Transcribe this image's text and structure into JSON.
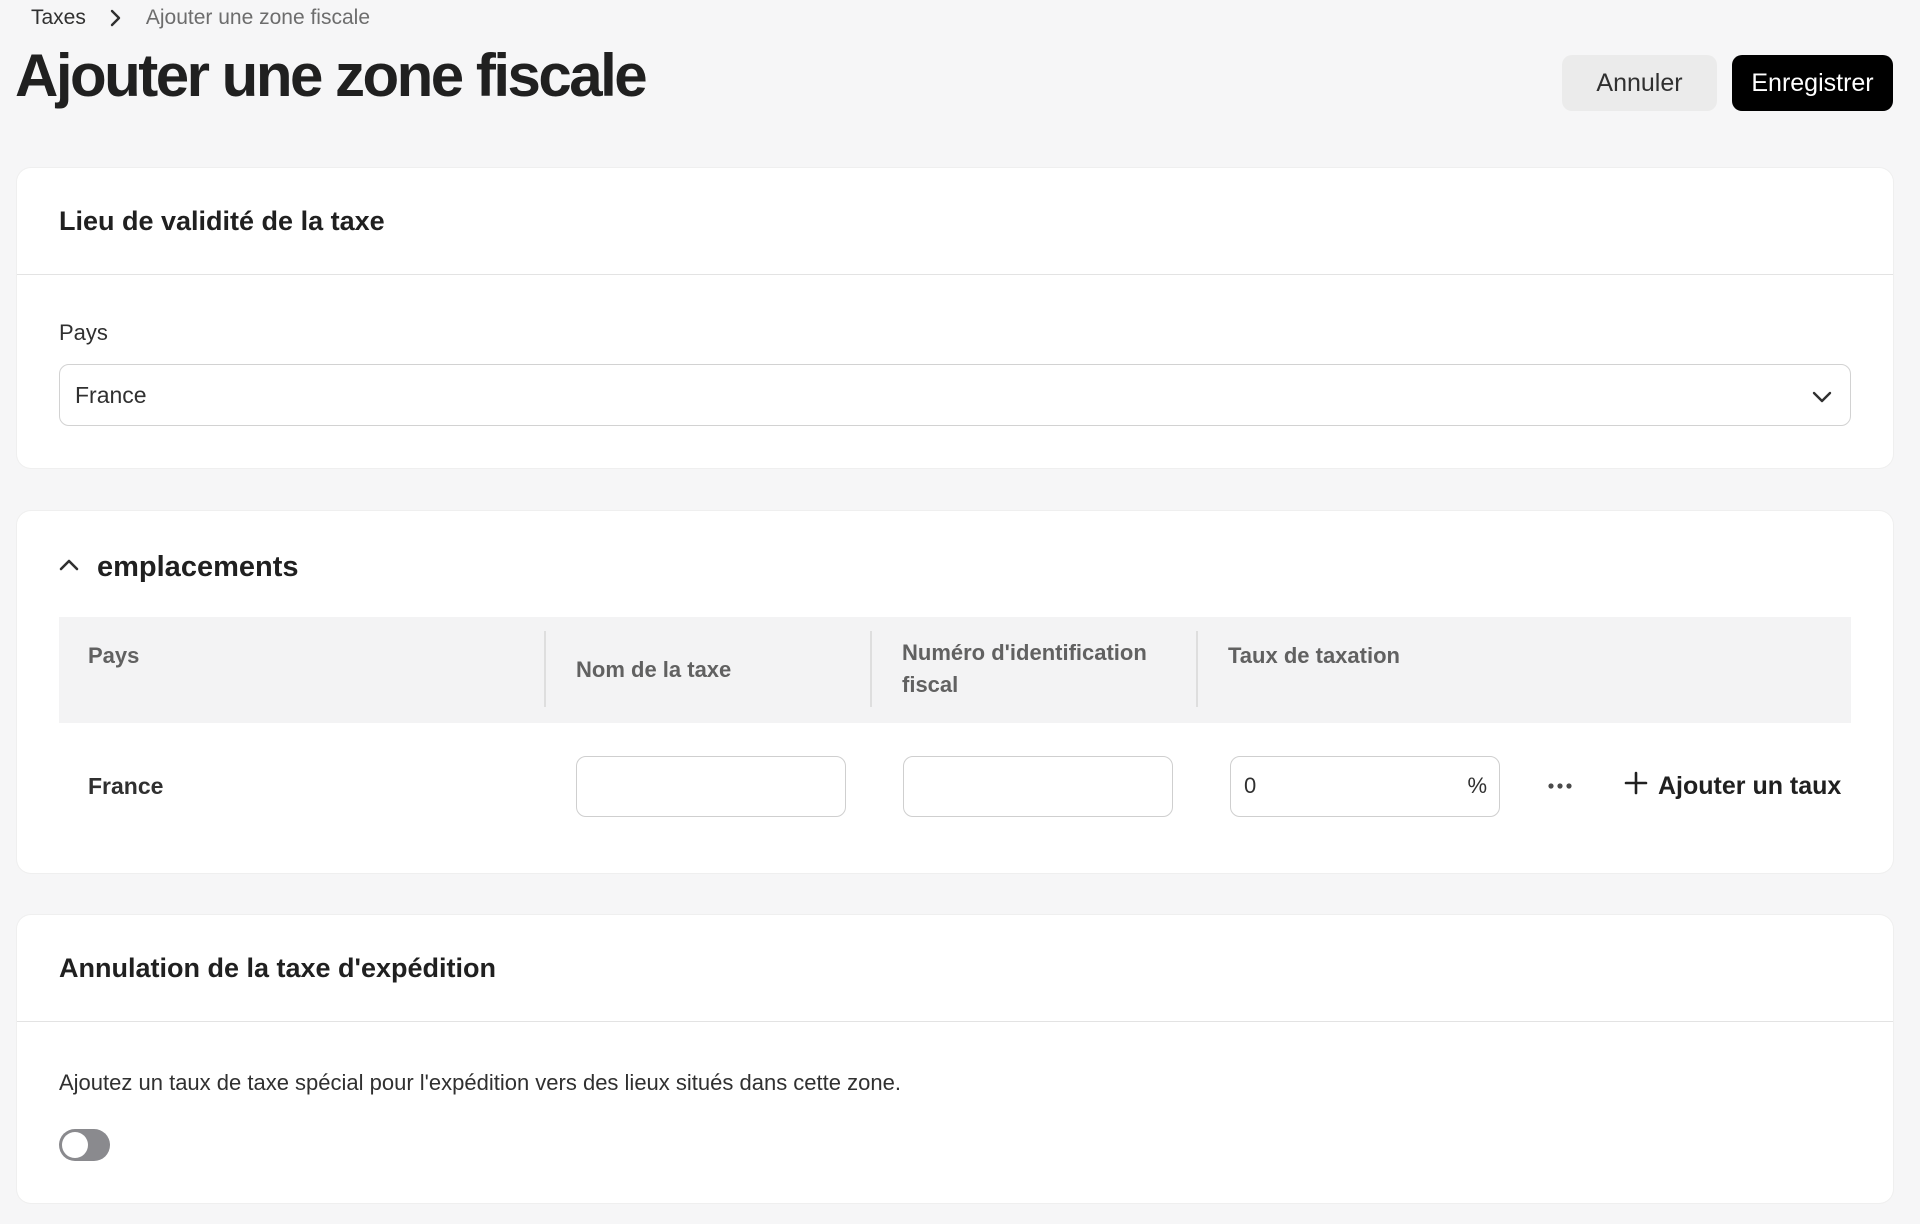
{
  "breadcrumb": {
    "parent": "Taxes",
    "current": "Ajouter une zone fiscale"
  },
  "page": {
    "title": "Ajouter une zone fiscale"
  },
  "actions": {
    "cancel_label": "Annuler",
    "save_label": "Enregistrer"
  },
  "validity": {
    "title": "Lieu de validité de la taxe",
    "country_label": "Pays",
    "country_value": "France"
  },
  "locations": {
    "title": "emplacements",
    "columns": [
      "Pays",
      "Nom de la taxe",
      "Numéro d'identification fiscal",
      "Taux de taxation"
    ],
    "rows": [
      {
        "country": "France",
        "tax_name": "",
        "tax_id": "",
        "rate": "0",
        "rate_unit": "%"
      }
    ],
    "add_rate_label": "Ajouter un taux"
  },
  "shipping_override": {
    "title": "Annulation de la taxe d'expédition",
    "description": "Ajoutez un taux de taxe spécial pour l'expédition vers des lieux situés dans cette zone.",
    "enabled": false
  },
  "icons": {
    "breadcrumb_sep": "chevron-right-icon",
    "select": "chevron-down-icon",
    "collapse": "chevron-up-icon",
    "more": "more-horizontal-icon",
    "add": "plus-icon"
  }
}
